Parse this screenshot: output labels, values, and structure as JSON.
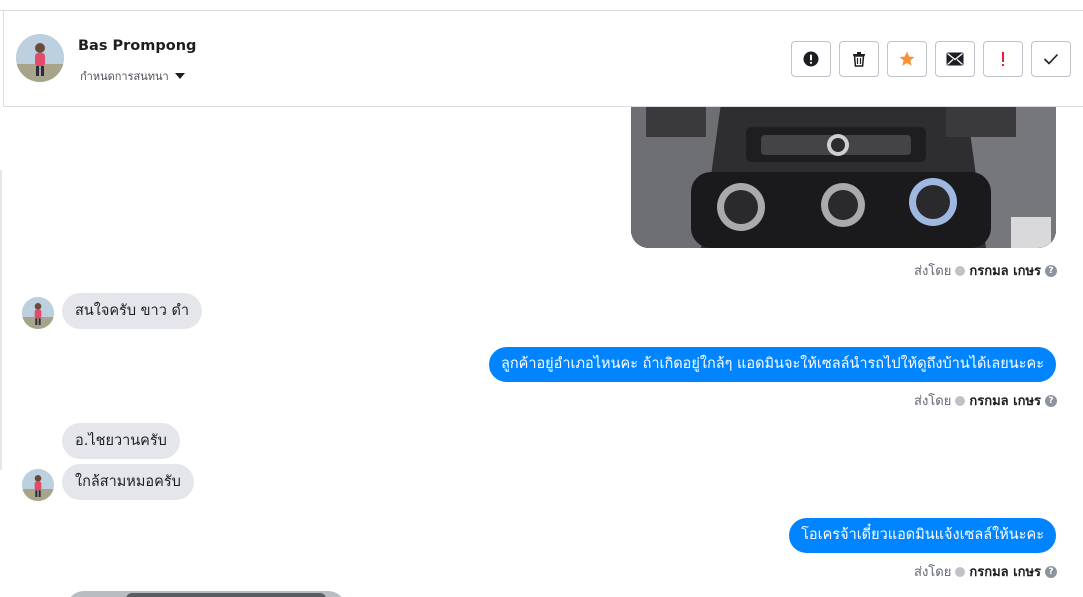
{
  "header": {
    "name": "Bas Prompong",
    "subtitle": "กำหนดการสนทนา",
    "actions": [
      {
        "name": "mark-spam-button",
        "icon": "alert-circle-icon"
      },
      {
        "name": "delete-button",
        "icon": "trash-icon"
      },
      {
        "name": "star-button",
        "icon": "star-icon",
        "color": "#f7923a"
      },
      {
        "name": "mark-unread-button",
        "icon": "envelope-icon"
      },
      {
        "name": "flag-button",
        "icon": "exclamation-icon",
        "color": "#e41e3f"
      },
      {
        "name": "done-button",
        "icon": "check-icon"
      }
    ]
  },
  "thread": {
    "sent_by_label": "ส่งโดย",
    "sender": "กรกมล เกษร",
    "messages": [
      {
        "type": "image",
        "direction": "outgoing",
        "icon": "car-console-photo"
      },
      {
        "type": "text",
        "direction": "incoming",
        "text": "สนใจครับ ขาว ดำ"
      },
      {
        "type": "text",
        "direction": "outgoing",
        "text": "ลูกค้าอยู่อำเภอไหนคะ ถ้าเกิดอยู่ใกล้ๆ แอดมินจะให้เซลล์นำรถไปให้ดูถึงบ้านได้เลยนะคะ"
      },
      {
        "type": "text",
        "direction": "incoming",
        "text": "อ.ไชยวานครับ"
      },
      {
        "type": "text",
        "direction": "incoming",
        "text": "ใกล้สามหมอครับ"
      },
      {
        "type": "text",
        "direction": "outgoing",
        "text": "โอเครจ้าเดี๋ยวแอดมินแจ้งเซลล์ให้นะคะ"
      }
    ]
  },
  "colors": {
    "outgoing_bubble": "#0084ff",
    "incoming_bubble": "#e4e6eb"
  }
}
